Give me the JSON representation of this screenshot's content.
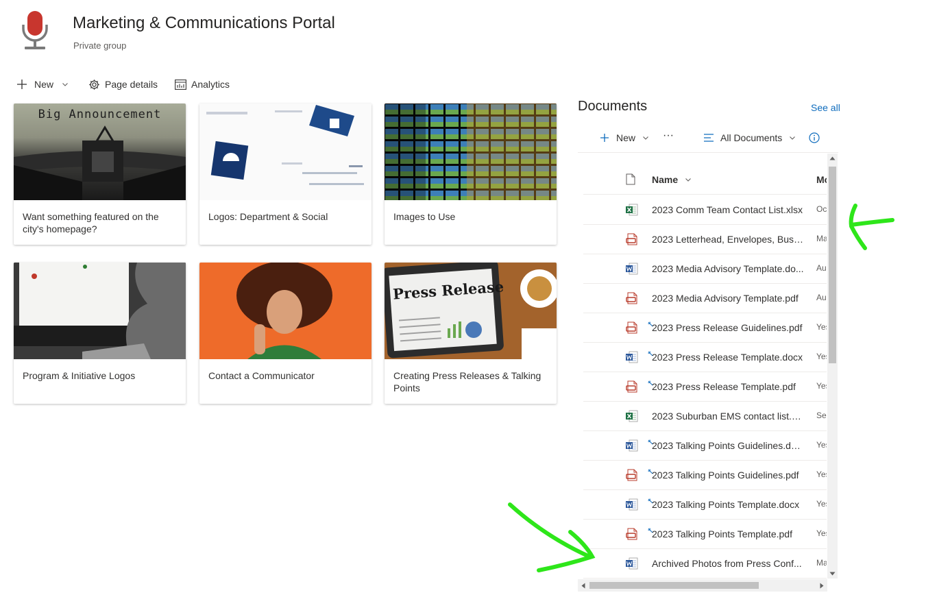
{
  "site": {
    "title": "Marketing & Communications Portal",
    "subtitle": "Private group",
    "logo_icon": "microphone-icon",
    "logo_color": "#c8362e"
  },
  "commandbar": {
    "new_label": "New",
    "page_details_label": "Page details",
    "analytics_label": "Analytics"
  },
  "tiles": [
    {
      "label": "Want something featured on the city's homepage?",
      "image_text": "Big Announcement",
      "image": "typewriter-image"
    },
    {
      "label": "Logos: Department & Social",
      "image": "logos-image"
    },
    {
      "label": "Images to Use",
      "image": "video-wall-image"
    },
    {
      "label": "Program & Initiative Logos",
      "image": "monitor-image"
    },
    {
      "label": "Contact a Communicator",
      "image": "woman-phone-gesture-image"
    },
    {
      "label": "Creating Press Releases & Talking Points",
      "image_text": "Press Release",
      "image": "tablet-newspaper-image"
    }
  ],
  "documents": {
    "title": "Documents",
    "see_all": "See all",
    "new_label": "New",
    "more_label": "···",
    "view_label": "All Documents",
    "col_name": "Name",
    "col_modified": "Mo",
    "accent": "#0f6cbd",
    "files": [
      {
        "name": "2023 Comm Team Contact List.xlsx",
        "type": "xlsx",
        "modified": "Oc",
        "new": false
      },
      {
        "name": "2023 Letterhead, Envelopes, Busin...",
        "type": "pdf",
        "modified": "Ma",
        "new": false
      },
      {
        "name": "2023 Media Advisory Template.do...",
        "type": "docx",
        "modified": "Au",
        "new": false
      },
      {
        "name": "2023 Media Advisory Template.pdf",
        "type": "pdf",
        "modified": "Au",
        "new": false
      },
      {
        "name": "2023 Press Release Guidelines.pdf",
        "type": "pdf",
        "modified": "Yes",
        "new": true
      },
      {
        "name": "2023 Press Release Template.docx",
        "type": "docx",
        "modified": "Yes",
        "new": true
      },
      {
        "name": "2023 Press Release Template.pdf",
        "type": "pdf",
        "modified": "Yes",
        "new": true
      },
      {
        "name": "2023 Suburban EMS contact list.xl...",
        "type": "xlsx",
        "modified": "Sep",
        "new": false
      },
      {
        "name": "2023 Talking Points Guidelines.docx",
        "type": "docx",
        "modified": "Yes",
        "new": true
      },
      {
        "name": "2023 Talking Points Guidelines.pdf",
        "type": "pdf",
        "modified": "Yes",
        "new": true
      },
      {
        "name": "2023 Talking Points Template.docx",
        "type": "docx",
        "modified": "Yes",
        "new": true
      },
      {
        "name": "2023 Talking Points Template.pdf",
        "type": "pdf",
        "modified": "Yes",
        "new": true
      },
      {
        "name": "Archived Photos from Press Conf...",
        "type": "docx",
        "modified": "Ma",
        "new": false
      }
    ]
  },
  "annotations": {
    "color": "#2ee61a",
    "marks": [
      "arrow-annotation-left",
      "arrow-annotation-down-right"
    ]
  }
}
